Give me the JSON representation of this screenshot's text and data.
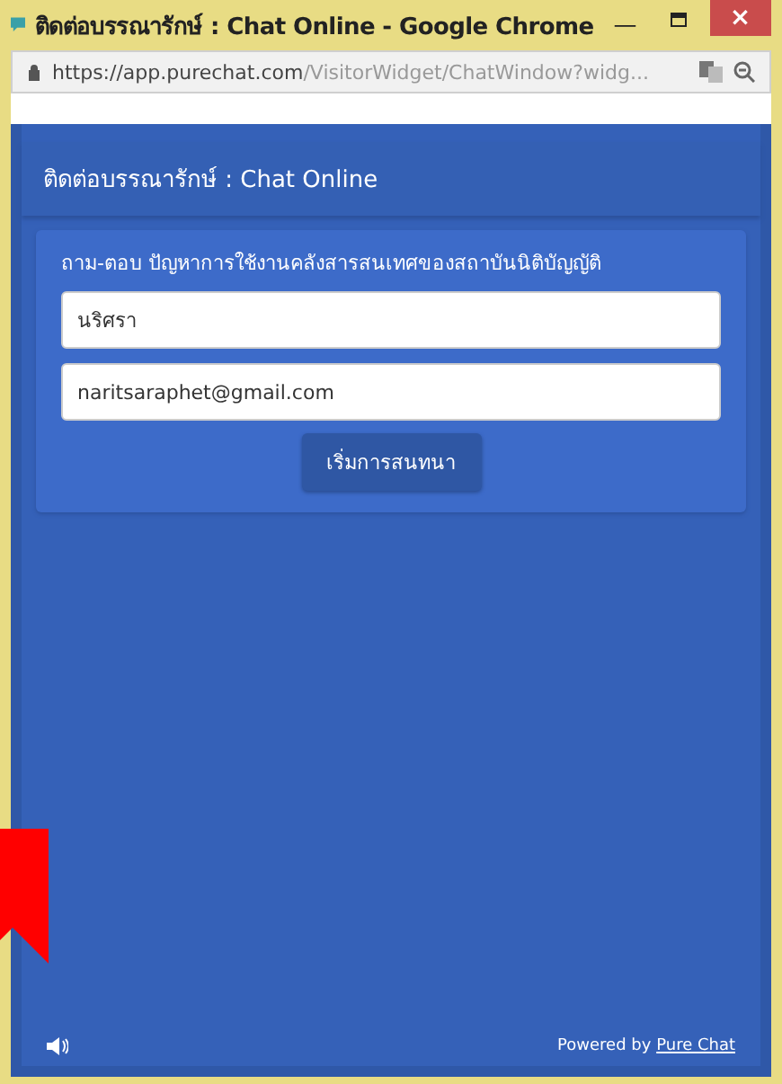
{
  "window": {
    "title": "ติดต่อบรรณารักษ์ : Chat Online - Google Chrome",
    "minimize": "—",
    "close": "×"
  },
  "address_bar": {
    "host": "https://app.purechat.com",
    "path": "/VisitorWidget/ChatWindow?widg..."
  },
  "chat": {
    "header": "ติดต่อบรรณารักษ์ : Chat Online",
    "prompt": "ถาม-ตอบ ปัญหาการใช้งานคลังสารสนเทศของสถาบันนิติบัญญัติ",
    "fields": [
      {
        "value": "นริศรา"
      },
      {
        "value": "naritsaraphet@gmail.com"
      }
    ],
    "start_button": "เริ่มการสนทนา",
    "powered_by": "Powered by",
    "powered_link": "Pure Chat"
  }
}
